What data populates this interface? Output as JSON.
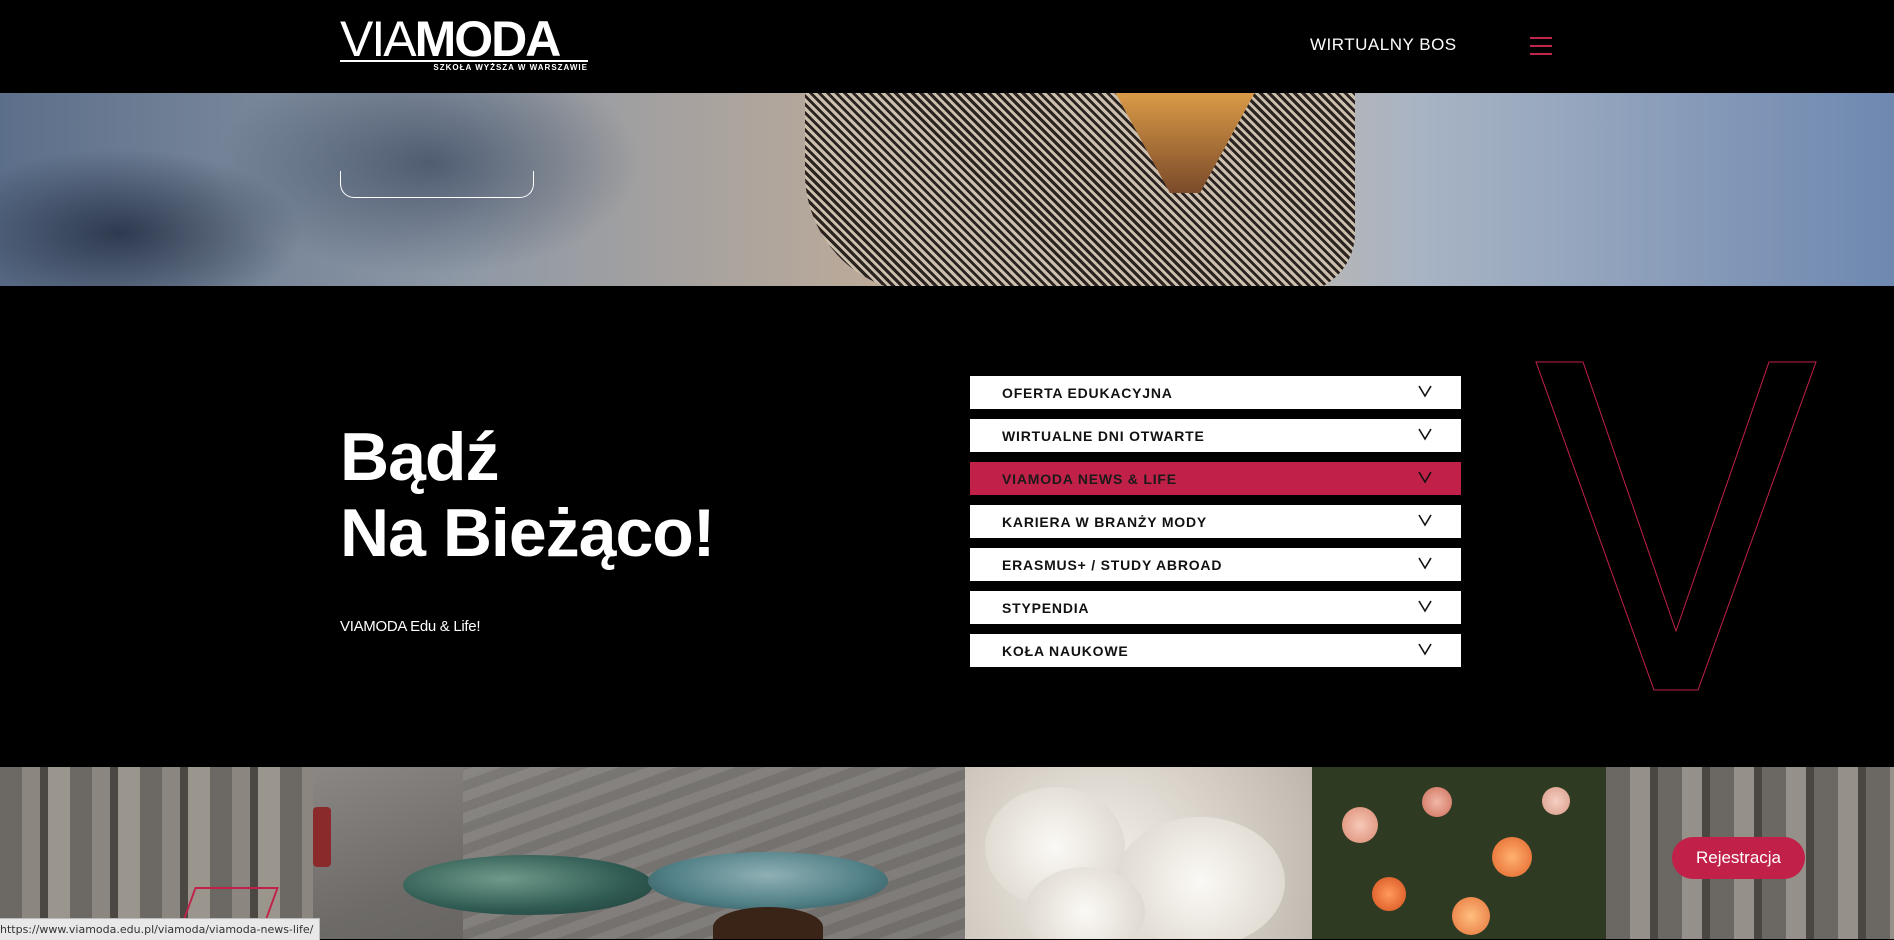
{
  "header": {
    "logo_via": "VIA",
    "logo_moda": "MODA",
    "logo_subtitle": "SZKOŁA WYŻSZA W WARSZAWIE",
    "nav_link": "WIRTUALNY BOS"
  },
  "section": {
    "heading_line1": "Bądź",
    "heading_line2": "Na Bieżąco!",
    "subtitle": "VIAMODA Edu & Life!"
  },
  "accordion": {
    "items": [
      {
        "label": "OFERTA EDUKACYJNA",
        "active": false
      },
      {
        "label": "WIRTUALNE DNI OTWARTE",
        "active": false
      },
      {
        "label": "VIAMODA NEWS & LIFE",
        "active": true
      },
      {
        "label": "KARIERA W BRANŻY MODY",
        "active": false
      },
      {
        "label": "ERASMUS+ / STUDY ABROAD",
        "active": false
      },
      {
        "label": "STYPENDIA",
        "active": false
      },
      {
        "label": "KOŁA NAUKOWE",
        "active": false
      }
    ]
  },
  "floating": {
    "register_button": "Rejestracja"
  },
  "status_bar": {
    "url": "https://www.viamoda.edu.pl/viamoda/viamoda-news-life/"
  },
  "colors": {
    "accent": "#c12148",
    "background": "#000000",
    "text": "#ffffff"
  },
  "icons": [
    "hamburger-menu-icon",
    "chevron-down-icon",
    "decorative-v-outline"
  ]
}
